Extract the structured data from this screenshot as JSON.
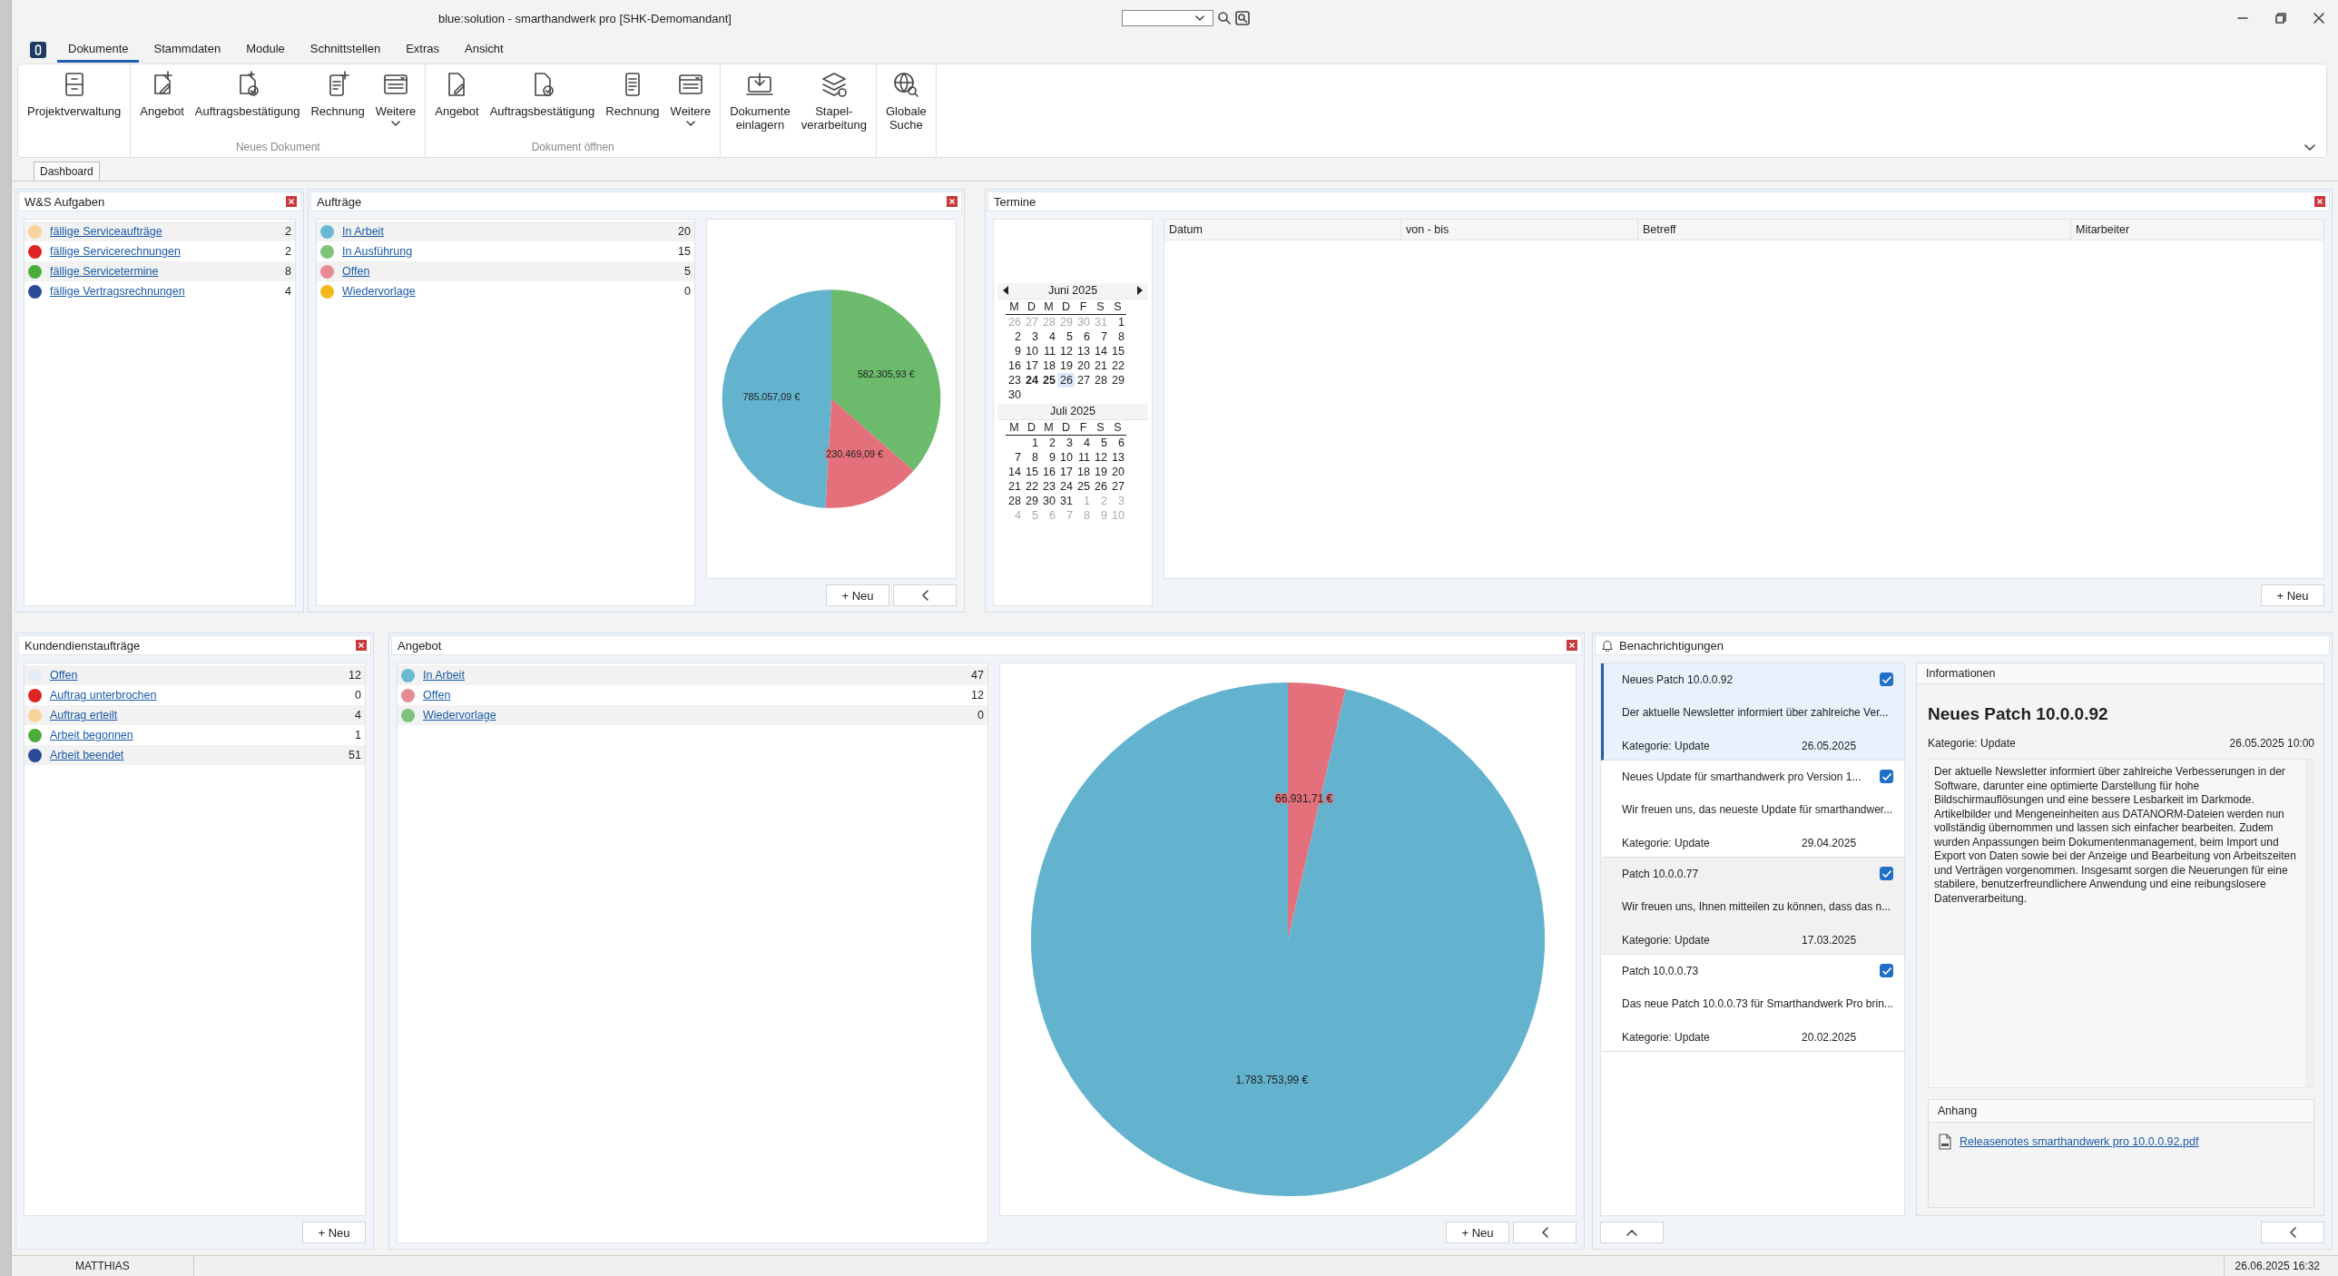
{
  "window": {
    "title": "blue:solution - smarthandwerk pro [SHK-Demomandant]"
  },
  "menu_tabs": [
    {
      "label": "Dokumente",
      "selected": true
    },
    {
      "label": "Stammdaten",
      "selected": false
    },
    {
      "label": "Module",
      "selected": false
    },
    {
      "label": "Schnittstellen",
      "selected": false
    },
    {
      "label": "Extras",
      "selected": false
    },
    {
      "label": "Ansicht",
      "selected": false
    }
  ],
  "ribbon": {
    "groups": [
      {
        "items": [
          {
            "kind": "cabinet",
            "lines": [
              "Projektverwaltung"
            ],
            "dropdown": false
          }
        ]
      },
      {
        "label": "Neues Dokument",
        "items": [
          {
            "kind": "doc-new",
            "lines": [
              "Angebot"
            ],
            "dropdown": false
          },
          {
            "kind": "doc-new-check",
            "lines": [
              "Auftragsbestätigung"
            ],
            "dropdown": false
          },
          {
            "kind": "invoice-new",
            "lines": [
              "Rechnung"
            ],
            "dropdown": false
          },
          {
            "kind": "more",
            "lines": [
              "Weitere"
            ],
            "dropdown": true
          }
        ]
      },
      {
        "label": "Dokument öffnen",
        "items": [
          {
            "kind": "doc",
            "lines": [
              "Angebot"
            ],
            "dropdown": false
          },
          {
            "kind": "doc-check",
            "lines": [
              "Auftragsbestätigung"
            ],
            "dropdown": false
          },
          {
            "kind": "invoice",
            "lines": [
              "Rechnung"
            ],
            "dropdown": false
          },
          {
            "kind": "more",
            "lines": [
              "Weitere"
            ],
            "dropdown": true
          }
        ]
      },
      {
        "items": [
          {
            "kind": "import",
            "lines": [
              "Dokumente",
              "einlagern"
            ],
            "dropdown": false
          },
          {
            "kind": "stack",
            "lines": [
              "Stapel-",
              "verarbeitung"
            ],
            "dropdown": false
          }
        ]
      },
      {
        "items": [
          {
            "kind": "globe",
            "lines": [
              "Globale",
              "Suche"
            ],
            "dropdown": false
          }
        ]
      }
    ]
  },
  "document_tabs": [
    {
      "label": "Dashboard",
      "selected": true
    }
  ],
  "dashboard": {
    "ws_tasks": {
      "title": "W&S Aufgaben",
      "closable": true,
      "items": [
        {
          "label": "fällige Serviceaufträge",
          "count": "2",
          "color": "#f9d39c"
        },
        {
          "label": "fällige Servicerechnungen",
          "count": "2",
          "color": "#e02424"
        },
        {
          "label": "fällige Servicetermine",
          "count": "8",
          "color": "#4aad3a"
        },
        {
          "label": "fällige Vertragsrechnungen",
          "count": "4",
          "color": "#2b4a9a"
        }
      ]
    },
    "orders": {
      "title": "Aufträge",
      "closable": true,
      "items": [
        {
          "label": "In Arbeit",
          "count": "20",
          "color": "#6ab8d1"
        },
        {
          "label": "In Ausführung",
          "count": "15",
          "color": "#7cc47c"
        },
        {
          "label": "Offen",
          "count": "5",
          "color": "#e78a94"
        },
        {
          "label": "Wiedervorlage",
          "count": "0",
          "color": "#f5b91c"
        }
      ],
      "chart_data": {
        "type": "pie",
        "values": [
          582305.93,
          230469.09,
          785057.09
        ],
        "colors": [
          "#6cbb6c",
          "#e3707a",
          "#63b3cf"
        ],
        "value_labels": [
          "582.305,93 €",
          "230.469,09 €",
          "785.057,09 €"
        ]
      },
      "buttons": [
        "+ Neu"
      ]
    },
    "appointments": {
      "title": "Termine",
      "closable": true,
      "calendar": {
        "months": [
          {
            "title": "Juni 2025",
            "nav": true,
            "weekdays": [
              "M",
              "D",
              "M",
              "D",
              "F",
              "S",
              "S"
            ],
            "weeks": [
              {
                "days": [
                  {
                    "d": "26",
                    "kind": "other",
                    "selected": false
                  },
                  {
                    "d": "27",
                    "kind": "other",
                    "selected": false
                  },
                  {
                    "d": "28",
                    "kind": "other",
                    "selected": false
                  },
                  {
                    "d": "29",
                    "kind": "other",
                    "selected": false
                  },
                  {
                    "d": "30",
                    "kind": "other",
                    "selected": false
                  },
                  {
                    "d": "31",
                    "kind": "other",
                    "selected": false
                  },
                  {
                    "d": "1",
                    "kind": "day",
                    "selected": false
                  }
                ]
              },
              {
                "days": [
                  {
                    "d": "2",
                    "kind": "day",
                    "selected": false
                  },
                  {
                    "d": "3",
                    "kind": "day",
                    "selected": false
                  },
                  {
                    "d": "4",
                    "kind": "day",
                    "selected": false
                  },
                  {
                    "d": "5",
                    "kind": "day",
                    "selected": false
                  },
                  {
                    "d": "6",
                    "kind": "day",
                    "selected": false
                  },
                  {
                    "d": "7",
                    "kind": "day",
                    "selected": false
                  },
                  {
                    "d": "8",
                    "kind": "day",
                    "selected": false
                  }
                ]
              },
              {
                "days": [
                  {
                    "d": "9",
                    "kind": "day",
                    "selected": false
                  },
                  {
                    "d": "10",
                    "kind": "day",
                    "selected": false
                  },
                  {
                    "d": "11",
                    "kind": "day",
                    "selected": false
                  },
                  {
                    "d": "12",
                    "kind": "day",
                    "selected": false
                  },
                  {
                    "d": "13",
                    "kind": "day",
                    "selected": false
                  },
                  {
                    "d": "14",
                    "kind": "day",
                    "selected": false
                  },
                  {
                    "d": "15",
                    "kind": "day",
                    "selected": false
                  }
                ]
              },
              {
                "days": [
                  {
                    "d": "16",
                    "kind": "day",
                    "selected": false
                  },
                  {
                    "d": "17",
                    "kind": "day",
                    "selected": false
                  },
                  {
                    "d": "18",
                    "kind": "day",
                    "selected": false
                  },
                  {
                    "d": "19",
                    "kind": "day",
                    "selected": false
                  },
                  {
                    "d": "20",
                    "kind": "day",
                    "selected": false
                  },
                  {
                    "d": "21",
                    "kind": "day",
                    "selected": false
                  },
                  {
                    "d": "22",
                    "kind": "day",
                    "selected": false
                  }
                ]
              },
              {
                "days": [
                  {
                    "d": "23",
                    "kind": "day",
                    "selected": false
                  },
                  {
                    "d": "24",
                    "kind": "marked",
                    "selected": false
                  },
                  {
                    "d": "25",
                    "kind": "marked",
                    "selected": false
                  },
                  {
                    "d": "26",
                    "kind": "day",
                    "selected": true
                  },
                  {
                    "d": "27",
                    "kind": "day",
                    "selected": false
                  },
                  {
                    "d": "28",
                    "kind": "day",
                    "selected": false
                  },
                  {
                    "d": "29",
                    "kind": "day",
                    "selected": false
                  }
                ]
              },
              {
                "leading_gap": false,
                "days": [
                  {
                    "d": "30",
                    "kind": "day",
                    "selected": false
                  }
                ]
              }
            ]
          },
          {
            "title": "Juli 2025",
            "nav": false,
            "weekdays": [
              "M",
              "D",
              "M",
              "D",
              "F",
              "S",
              "S"
            ],
            "weeks": [
              {
                "leading_gap": true,
                "days": [
                  {
                    "d": "1",
                    "kind": "day",
                    "selected": false
                  },
                  {
                    "d": "2",
                    "kind": "day",
                    "selected": false
                  },
                  {
                    "d": "3",
                    "kind": "day",
                    "selected": false
                  },
                  {
                    "d": "4",
                    "kind": "day",
                    "selected": false
                  },
                  {
                    "d": "5",
                    "kind": "day",
                    "selected": false
                  },
                  {
                    "d": "6",
                    "kind": "day",
                    "selected": false
                  }
                ]
              },
              {
                "days": [
                  {
                    "d": "7",
                    "kind": "day",
                    "selected": false
                  },
                  {
                    "d": "8",
                    "kind": "day",
                    "selected": false
                  },
                  {
                    "d": "9",
                    "kind": "day",
                    "selected": false
                  },
                  {
                    "d": "10",
                    "kind": "day",
                    "selected": false
                  },
                  {
                    "d": "11",
                    "kind": "day",
                    "selected": false
                  },
                  {
                    "d": "12",
                    "kind": "day",
                    "selected": false
                  },
                  {
                    "d": "13",
                    "kind": "day",
                    "selected": false
                  }
                ]
              },
              {
                "days": [
                  {
                    "d": "14",
                    "kind": "day",
                    "selected": false
                  },
                  {
                    "d": "15",
                    "kind": "day",
                    "selected": false
                  },
                  {
                    "d": "16",
                    "kind": "day",
                    "selected": false
                  },
                  {
                    "d": "17",
                    "kind": "day",
                    "selected": false
                  },
                  {
                    "d": "18",
                    "kind": "day",
                    "selected": false
                  },
                  {
                    "d": "19",
                    "kind": "day",
                    "selected": false
                  },
                  {
                    "d": "20",
                    "kind": "day",
                    "selected": false
                  }
                ]
              },
              {
                "days": [
                  {
                    "d": "21",
                    "kind": "day",
                    "selected": false
                  },
                  {
                    "d": "22",
                    "kind": "day",
                    "selected": false
                  },
                  {
                    "d": "23",
                    "kind": "day",
                    "selected": false
                  },
                  {
                    "d": "24",
                    "kind": "day",
                    "selected": false
                  },
                  {
                    "d": "25",
                    "kind": "day",
                    "selected": false
                  },
                  {
                    "d": "26",
                    "kind": "day",
                    "selected": false
                  },
                  {
                    "d": "27",
                    "kind": "day",
                    "selected": false
                  }
                ]
              },
              {
                "days": [
                  {
                    "d": "28",
                    "kind": "day",
                    "selected": false
                  },
                  {
                    "d": "29",
                    "kind": "day",
                    "selected": false
                  },
                  {
                    "d": "30",
                    "kind": "day",
                    "selected": false
                  },
                  {
                    "d": "31",
                    "kind": "day",
                    "selected": false
                  },
                  {
                    "d": "1",
                    "kind": "other",
                    "selected": false
                  },
                  {
                    "d": "2",
                    "kind": "other",
                    "selected": false
                  },
                  {
                    "d": "3",
                    "kind": "other",
                    "selected": false
                  }
                ]
              },
              {
                "days": [
                  {
                    "d": "4",
                    "kind": "other",
                    "selected": false
                  },
                  {
                    "d": "5",
                    "kind": "other",
                    "selected": false
                  },
                  {
                    "d": "6",
                    "kind": "other",
                    "selected": false
                  },
                  {
                    "d": "7",
                    "kind": "other",
                    "selected": false
                  },
                  {
                    "d": "8",
                    "kind": "other",
                    "selected": false
                  },
                  {
                    "d": "9",
                    "kind": "other",
                    "selected": false
                  },
                  {
                    "d": "10",
                    "kind": "other",
                    "selected": false
                  }
                ]
              }
            ]
          }
        ]
      },
      "table": {
        "columns": [
          "Datum",
          "von - bis",
          "Betreff",
          "Mitarbeiter"
        ]
      },
      "buttons": [
        "+ Neu"
      ]
    },
    "service_orders": {
      "title": "Kundendienstaufträge",
      "closable": true,
      "items": [
        {
          "label": "Offen",
          "count": "12",
          "color": "#e6ecf7"
        },
        {
          "label": "Auftrag unterbrochen",
          "count": "0",
          "color": "#e02424"
        },
        {
          "label": "Auftrag erteilt",
          "count": "4",
          "color": "#f9d39c"
        },
        {
          "label": "Arbeit begonnen",
          "count": "1",
          "color": "#4aad3a"
        },
        {
          "label": "Arbeit beendet",
          "count": "51",
          "color": "#2b4a9a"
        }
      ],
      "buttons": [
        "+ Neu"
      ]
    },
    "offers": {
      "title": "Angebot",
      "closable": true,
      "items": [
        {
          "label": "In Arbeit",
          "count": "47",
          "color": "#6ab8d1"
        },
        {
          "label": "Offen",
          "count": "12",
          "color": "#e78a94"
        },
        {
          "label": "Wiedervorlage",
          "count": "0",
          "color": "#7cc47c"
        }
      ],
      "chart_data": {
        "type": "pie",
        "values": [
          66931.71,
          1783753.99
        ],
        "colors": [
          "#e3707a",
          "#63b3cf"
        ],
        "value_labels": [
          "66.931,71 €",
          "1.783.753,99 €"
        ]
      },
      "buttons": [
        "+ Neu"
      ]
    },
    "notifications": {
      "title": "Benachrichtigungen",
      "items": [
        {
          "title": "Neues Patch 10.0.0.92",
          "text": "Der aktuelle Newsletter informiert über zahlreiche Ver...",
          "category": "Kategorie: Update",
          "date": "26.05.2025",
          "read": true,
          "selected": true,
          "hovered": false
        },
        {
          "title": "Neues Update für smarthandwerk pro Version 1...",
          "text": "Wir freuen uns, das neueste Update für smarthandwer...",
          "category": "Kategorie: Update",
          "date": "29.04.2025",
          "read": true,
          "selected": false,
          "hovered": false
        },
        {
          "title": "Patch 10.0.0.77",
          "text": "Wir freuen uns, Ihnen mitteilen zu können, dass das n...",
          "category": "Kategorie: Update",
          "date": "17.03.2025",
          "read": true,
          "selected": false,
          "hovered": true
        },
        {
          "title": "Patch 10.0.0.73",
          "text": "Das neue Patch 10.0.0.73 für Smarthandwerk Pro brin...",
          "category": "Kategorie: Update",
          "date": "20.02.2025",
          "read": true,
          "selected": false,
          "hovered": false
        }
      ],
      "info": {
        "header": "Informationen",
        "title": "Neues Patch 10.0.0.92",
        "category": "Kategorie: Update",
        "datetime": "26.05.2025 10:00",
        "body": "Der aktuelle Newsletter informiert über zahlreiche Verbesserungen in der Software, darunter eine optimierte Darstellung für hohe Bildschirmauflösungen und eine bessere Lesbarkeit im Darkmode. Artikelbilder und Mengeneinheiten aus DATANORM-Dateien werden nun vollständig übernommen und lassen sich einfacher bearbeiten. Zudem wurden Anpassungen beim Dokumentenmanagement, beim Import und Export von Daten sowie bei der Anzeige und Bearbeitung von Arbeitszeiten und Verträgen vorgenommen. Insgesamt sorgen die Neuerungen für eine stabilere, benutzerfreundlichere Anwendung und eine reibungslosere Datenverarbeitung.",
        "attachments_header": "Anhang",
        "attachment": "Releasenotes smarthandwerk pro 10.0.0.92.pdf"
      }
    }
  },
  "status_bar": {
    "user": "MATTHIAS",
    "datetime": "26.06.2025 16:32"
  }
}
